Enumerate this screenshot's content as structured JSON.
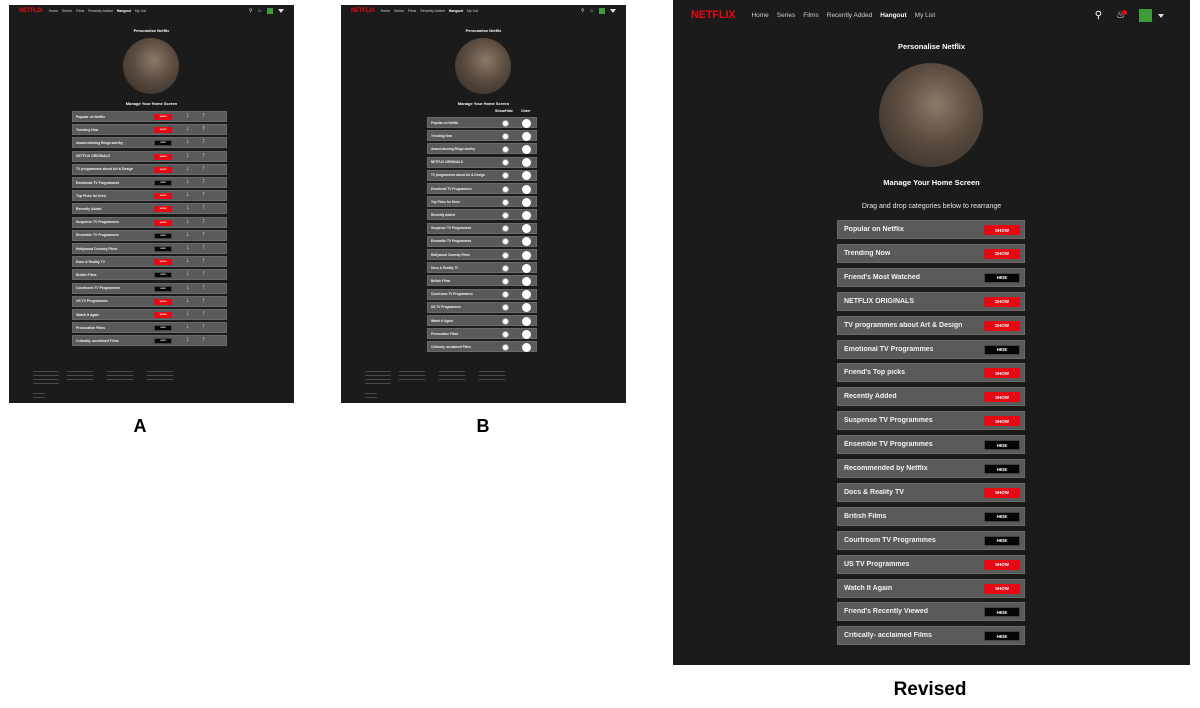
{
  "nav": {
    "logo": "NETFLIX",
    "links": [
      "Home",
      "Series",
      "Films",
      "Recently Added",
      "Hangout",
      "My List"
    ],
    "active_link": "Hangout",
    "icons": [
      "search-icon",
      "bell-icon",
      "profile-avatar",
      "caret-down-icon"
    ]
  },
  "page": {
    "title": "Personalise Netflix",
    "section_title": "Manage Your Home Screen",
    "instruction": "Drag and drop categories below to rearrange",
    "col_show_hide": "Show/Hide",
    "col_order": "Order"
  },
  "captions": {
    "a": "A",
    "b": "B",
    "revised": "Revised"
  },
  "screen_a_rows": [
    {
      "label": "Popular on Netflix",
      "state": "SHOW"
    },
    {
      "label": "Trending Now",
      "state": "SHOW"
    },
    {
      "label": "Award-winning Binge-worthy",
      "state": "HIDE"
    },
    {
      "label": "NETFLIX ORIGINALS",
      "state": "SHOW"
    },
    {
      "label": "TV programmes about Art & Design",
      "state": "SHOW"
    },
    {
      "label": "Emotional TV Programmes",
      "state": "HIDE"
    },
    {
      "label": "Top Picks for Drew",
      "state": "SHOW"
    },
    {
      "label": "Recently Added",
      "state": "SHOW"
    },
    {
      "label": "Suspense TV Programmes",
      "state": "SHOW"
    },
    {
      "label": "Ensemble TV Programmes",
      "state": "HIDE"
    },
    {
      "label": "Hollywood Comedy Films",
      "state": "HIDE"
    },
    {
      "label": "Docs & Reality TV",
      "state": "SHOW"
    },
    {
      "label": "British Films",
      "state": "HIDE"
    },
    {
      "label": "Courtroom TV Programmes",
      "state": "HIDE"
    },
    {
      "label": "US TV Programmes",
      "state": "SHOW"
    },
    {
      "label": "Watch It Again",
      "state": "SHOW"
    },
    {
      "label": "Provocative Films",
      "state": "HIDE"
    },
    {
      "label": "Critically- acclaimed Films",
      "state": "HIDE"
    }
  ],
  "screen_b_rows": [
    "Popular on Netflix",
    "Trending Now",
    "Award-winning Binge-worthy",
    "NETFLIX ORIGINALS",
    "TV programmes about Art & Design",
    "Emotional TV Programmes",
    "Top Picks for Drew",
    "Recently Added",
    "Suspense TV Programmes",
    "Ensemble TV Programmes",
    "Hollywood Comedy Films",
    "Docs & Reality TV",
    "British Films",
    "Courtroom TV Programmes",
    "US TV Programmes",
    "Watch It Again",
    "Provocative Films",
    "Critically- acclaimed Films"
  ],
  "revised_rows": [
    {
      "label": "Popular on Netflix",
      "state": "SHOW"
    },
    {
      "label": "Trending Now",
      "state": "SHOW"
    },
    {
      "label": "Friend's Most Watched",
      "state": "HIDE"
    },
    {
      "label": "NETFLIX ORIGINALS",
      "state": "SHOW"
    },
    {
      "label": "TV programmes about Art & Design",
      "state": "SHOW"
    },
    {
      "label": "Emotional TV Programmes",
      "state": "HIDE"
    },
    {
      "label": "Friend's Top picks",
      "state": "SHOW"
    },
    {
      "label": "Recently Added",
      "state": "SHOW"
    },
    {
      "label": "Suspense TV Programmes",
      "state": "SHOW"
    },
    {
      "label": "Ensemble TV Programmes",
      "state": "HIDE"
    },
    {
      "label": "Recommended by Netflix",
      "state": "HIDE"
    },
    {
      "label": "Docs & Reality TV",
      "state": "SHOW"
    },
    {
      "label": "British Films",
      "state": "HIDE"
    },
    {
      "label": "Courtroom TV Programmes",
      "state": "HIDE"
    },
    {
      "label": "US TV Programmes",
      "state": "SHOW"
    },
    {
      "label": "Watch It Again",
      "state": "SHOW"
    },
    {
      "label": "Friend's Recently Viewed",
      "state": "HIDE"
    },
    {
      "label": "Critically- acclaimed Films",
      "state": "HIDE"
    }
  ],
  "colors": {
    "accent": "#e50914",
    "background": "#1b1b1b",
    "row": "#5a5a5a",
    "hide_button": "#050505",
    "avatar": "#3f9b3a"
  }
}
